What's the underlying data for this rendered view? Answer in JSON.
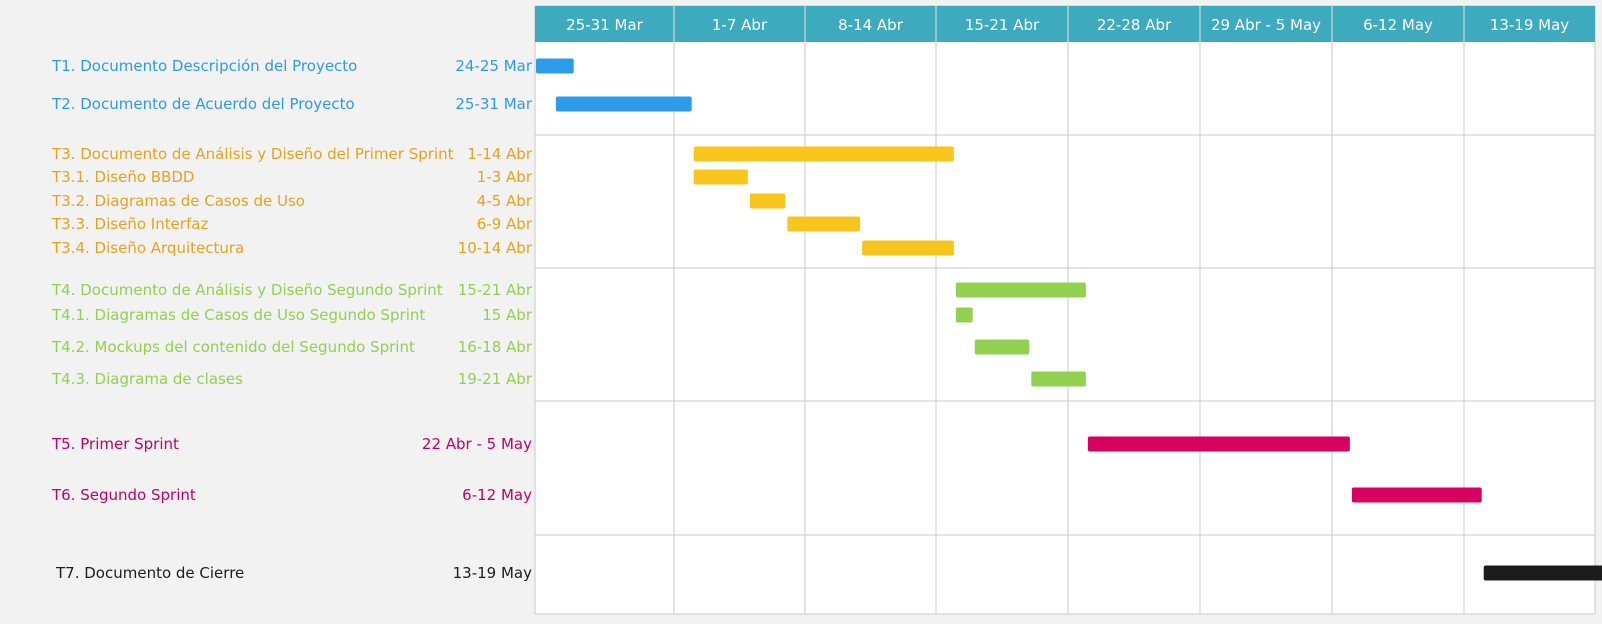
{
  "chart_data": {
    "type": "gantt",
    "weeks": [
      "25-31 Mar",
      "1-7 Abr",
      "8-14 Abr",
      "15-21 Abr",
      "22-28 Abr",
      "29 Abr - 5 May",
      "6-12 May",
      "13-19 May"
    ],
    "x_range": [
      "2024-03-24",
      "2024-05-19"
    ],
    "colors": {
      "header": "#3dabbd",
      "grid": "#c8c8c8",
      "panel": "#ffffff",
      "background": "#f2f2f2",
      "blue": "#2e9be8",
      "yellow": "#f7c51b",
      "yellow_text": "#e8a21c",
      "green": "#92d050",
      "pink": "#d8005f",
      "pink_text": "#c1006b",
      "black": "#1c1c1c"
    },
    "groups": [
      {
        "bar_color": "#2e9be8",
        "text_color": "#2e9be8",
        "tasks": [
          {
            "label": "T1. Documento Descripción del Proyecto",
            "dates": "24-25 Mar",
            "start": "2024-03-24",
            "end": "2024-03-25"
          },
          {
            "label": "T2. Documento de Acuerdo del Proyecto",
            "dates": "25-31 Mar",
            "start": "2024-03-25",
            "end": "2024-03-31"
          }
        ]
      },
      {
        "bar_color": "#f7c51b",
        "text_color": "#e8a21c",
        "tasks": [
          {
            "label": "T3. Documento de Análisis y Diseño del Primer Sprint",
            "dates": "1-14 Abr",
            "start": "2024-04-01",
            "end": "2024-04-14"
          },
          {
            "label": "T3.1. Diseño BBDD",
            "dates": "1-3 Abr",
            "start": "2024-04-01",
            "end": "2024-04-03"
          },
          {
            "label": "T3.2. Diagramas de Casos de Uso",
            "dates": "4-5 Abr",
            "start": "2024-04-04",
            "end": "2024-04-05"
          },
          {
            "label": "T3.3. Diseño Interfaz",
            "dates": "6-9 Abr",
            "start": "2024-04-06",
            "end": "2024-04-09"
          },
          {
            "label": "T3.4. Diseño Arquitectura",
            "dates": "10-14 Abr",
            "start": "2024-04-10",
            "end": "2024-04-14"
          }
        ]
      },
      {
        "bar_color": "#92d050",
        "text_color": "#92d050",
        "tasks": [
          {
            "label": "T4. Documento de Análisis y Diseño Segundo Sprint",
            "dates": "15-21 Abr",
            "start": "2024-04-15",
            "end": "2024-04-21"
          },
          {
            "label": "T4.1. Diagramas de Casos de Uso Segundo Sprint",
            "dates": "15 Abr",
            "start": "2024-04-15",
            "end": "2024-04-15"
          },
          {
            "label": "T4.2. Mockups del contenido del Segundo Sprint",
            "dates": "16-18 Abr",
            "start": "2024-04-16",
            "end": "2024-04-18"
          },
          {
            "label": "T4.3. Diagrama de clases",
            "dates": "19-21 Abr",
            "start": "2024-04-19",
            "end": "2024-04-21"
          }
        ]
      },
      {
        "bar_color": "#d8005f",
        "text_color": "#c1006b",
        "tasks": [
          {
            "label": "T5. Primer Sprint",
            "dates": "22 Abr - 5 May",
            "start": "2024-04-22",
            "end": "2024-05-05"
          },
          {
            "label": "T6. Segundo Sprint",
            "dates": "6-12 May",
            "start": "2024-05-06",
            "end": "2024-05-12"
          }
        ]
      },
      {
        "bar_color": "#1c1c1c",
        "text_color": "#1c1c1c",
        "tasks": [
          {
            "label": "T7. Documento de Cierre",
            "dates": "13-19 May",
            "start": "2024-05-13",
            "end": "2024-05-19"
          }
        ]
      }
    ]
  }
}
